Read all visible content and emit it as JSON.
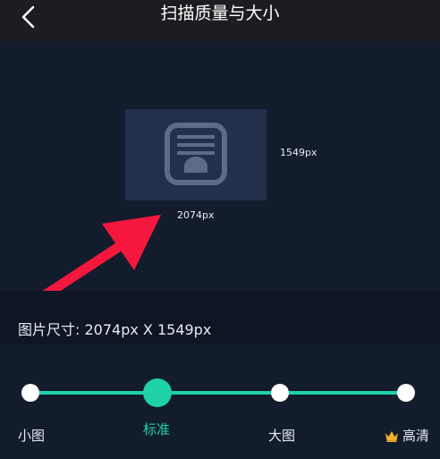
{
  "nav": {
    "title": "扫描质量与大小"
  },
  "preview": {
    "height_label": "1549px",
    "width_label": "2074px"
  },
  "size_info": {
    "label": "图片尺寸:  2074px X 1549px"
  },
  "slider": {
    "selected_index": 1,
    "options": [
      {
        "label": "小图",
        "icon": ""
      },
      {
        "label": "标准",
        "icon": ""
      },
      {
        "label": "大图",
        "icon": ""
      },
      {
        "label": "高清",
        "icon": "crown-icon"
      }
    ]
  },
  "colors": {
    "accent": "#1fd1a7",
    "background": "#131c2c",
    "navbar": "#1c1d21",
    "annotation_arrow": "#f5173d",
    "crown": "#f3b22c"
  }
}
